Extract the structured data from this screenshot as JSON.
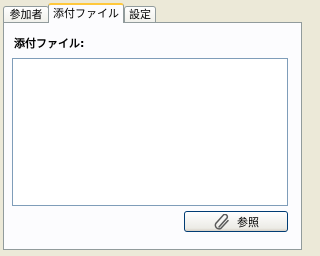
{
  "tabs": [
    {
      "label": "参加者"
    },
    {
      "label": "添付ファイル"
    },
    {
      "label": "設定"
    }
  ],
  "attachments": {
    "label": "添付ファイル:",
    "items": []
  },
  "browse_button": {
    "label": "参照",
    "icon": "paperclip-icon"
  }
}
